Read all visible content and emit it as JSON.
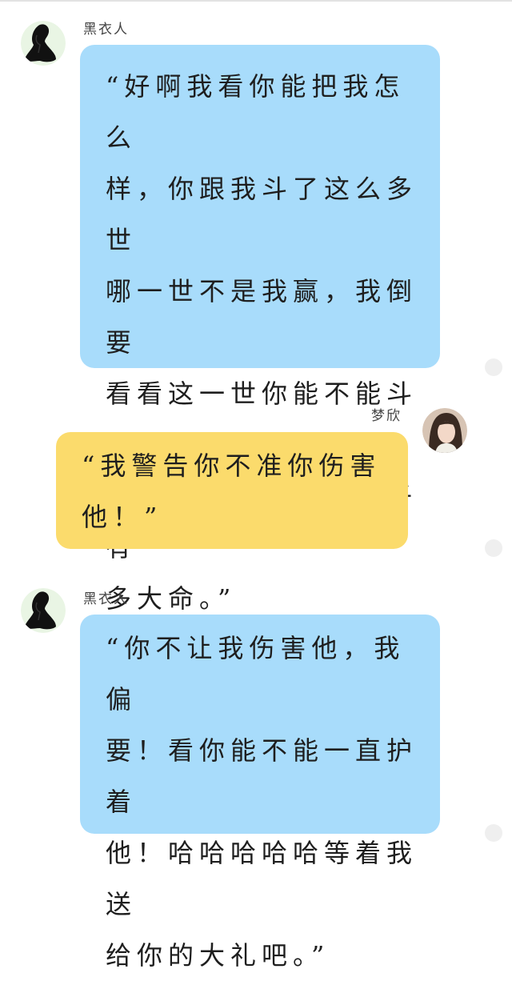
{
  "messages": [
    {
      "sender": "黑衣人",
      "avatar_icon": "black-robed-figure-icon",
      "side": "left",
      "bubble_color": "#a8dcfb",
      "text": "“好啊我看你能把我怎么\n样，你跟我斗了这么多世\n哪一世不是我赢，我倒要\n看看这一世你能不能斗得\n过我，顺便看看那小子有\n多大命。”"
    },
    {
      "sender": "梦欣",
      "avatar_icon": "girl-portrait-avatar",
      "side": "right",
      "bubble_color": "#fbdb6c",
      "text": "“我警告你不准你伤害\n他！”"
    },
    {
      "sender": "黑衣人",
      "avatar_icon": "black-robed-figure-icon",
      "side": "left",
      "bubble_color": "#a8dcfb",
      "text": "“你不让我伤害他，我偏\n要！看你能不能一直护着\n他！哈哈哈哈哈等着我送\n给你的大礼吧。”"
    }
  ]
}
